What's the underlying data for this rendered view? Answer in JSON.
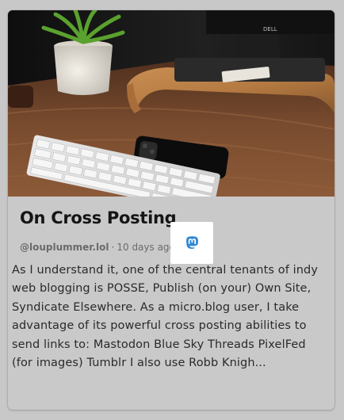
{
  "post": {
    "title": "On Cross Posting",
    "author": "@louplummer.lol",
    "separator_dot": "·",
    "time_ago": "10 days ago",
    "divider": "|",
    "crosspost_icon": "mastodon-icon",
    "excerpt": "As I understand it, one of the central tenants of indy web blogging is POSSE, Publish (on your) Own Site, Syndicate Elsewhere. As a micro.blog user, I take advantage of its powerful cross posting abilities to send links to: Mastodon Blue Sky Threads PixelFed (for images) Tumblr I also use Robb Knigh..."
  },
  "hero_image": {
    "monitor_brand": "DELL"
  },
  "colors": {
    "page_bg": "#c8c8c8",
    "card_bg": "#c9c9c9",
    "title": "#151515",
    "meta": "#6b6b6b",
    "mastodon_blue": "#3088d4"
  }
}
